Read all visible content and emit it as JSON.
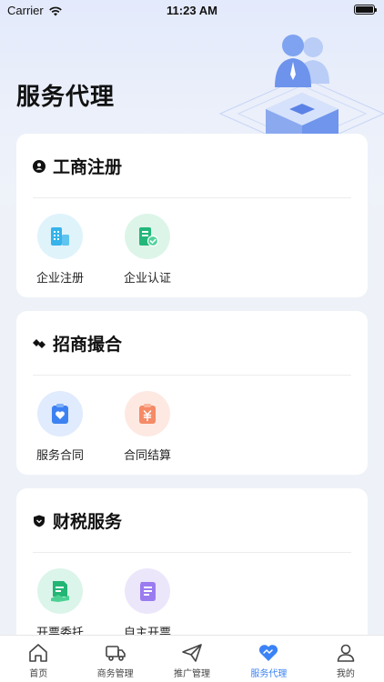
{
  "status": {
    "carrier": "Carrier",
    "time": "11:23 AM"
  },
  "page_title": "服务代理",
  "sections": [
    {
      "title": "工商注册",
      "items": [
        {
          "label": "企业注册"
        },
        {
          "label": "企业认证"
        }
      ]
    },
    {
      "title": "招商撮合",
      "items": [
        {
          "label": "服务合同"
        },
        {
          "label": "合同结算"
        }
      ]
    },
    {
      "title": "财税服务",
      "items": [
        {
          "label": "开票委托"
        },
        {
          "label": "自主开票"
        }
      ]
    }
  ],
  "tabs": [
    {
      "label": "首页",
      "icon": "home-icon",
      "active": false
    },
    {
      "label": "商务管理",
      "icon": "truck-icon",
      "active": false
    },
    {
      "label": "推广管理",
      "icon": "paper-plane-icon",
      "active": false
    },
    {
      "label": "服务代理",
      "icon": "heart-handshake-icon",
      "active": true
    },
    {
      "label": "我的",
      "icon": "user-icon",
      "active": false
    }
  ],
  "colors": {
    "accent": "#3b82f6",
    "tab_inactive": "#444444"
  }
}
